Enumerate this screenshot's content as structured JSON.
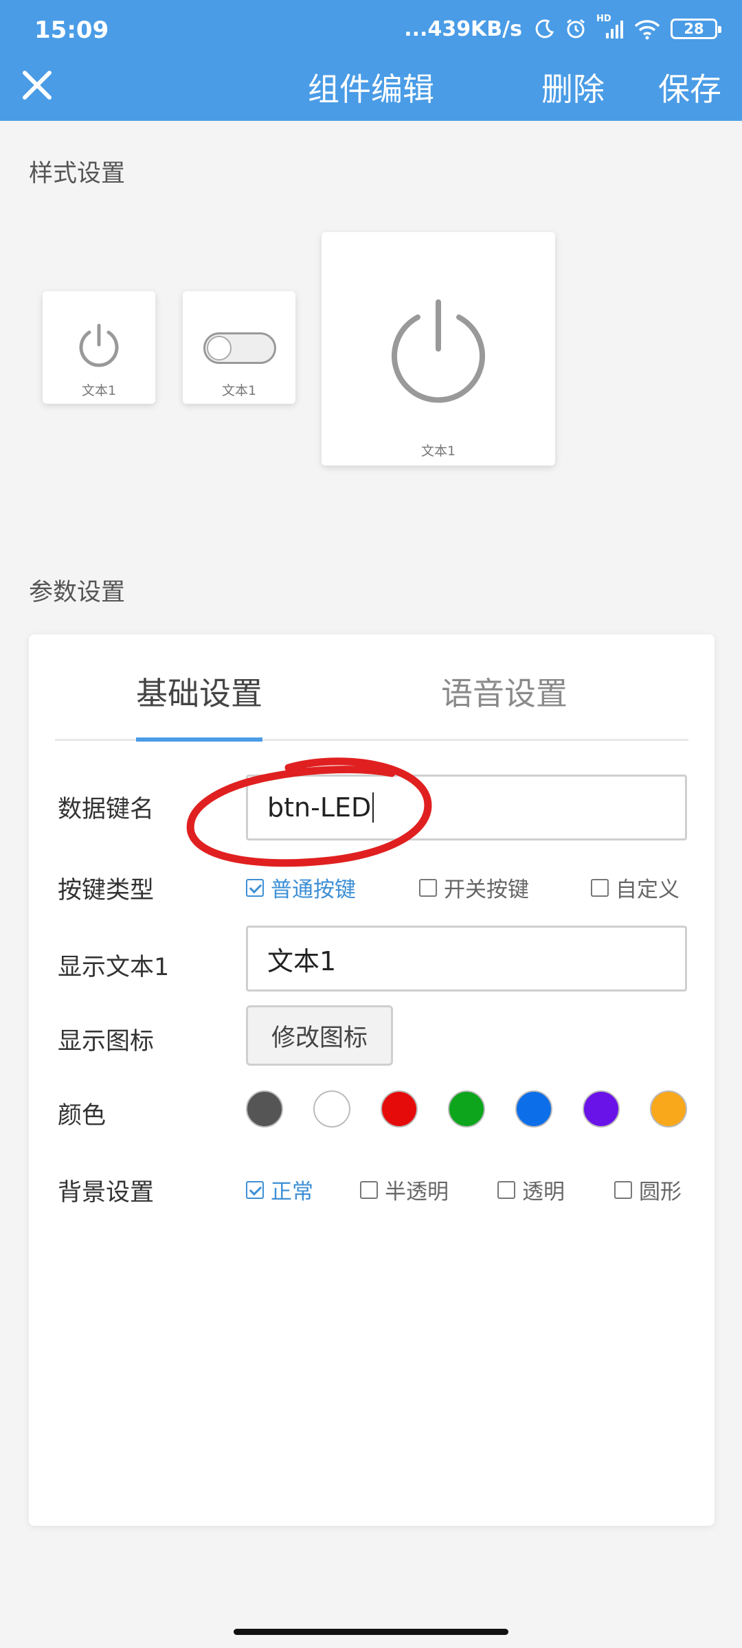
{
  "status_bar": {
    "time": "15:09",
    "network_speed": "...439KB/s",
    "network_type": "HD",
    "battery": "28",
    "icons": [
      "moon-icon",
      "alarm-icon",
      "signal-icon",
      "wifi-icon",
      "battery-icon"
    ]
  },
  "header": {
    "close_icon": "close-icon",
    "title": "组件编辑",
    "delete_label": "删除",
    "save_label": "保存"
  },
  "style_section": {
    "title": "样式设置",
    "cards": [
      {
        "label": "文本1",
        "icon": "power-icon"
      },
      {
        "label": "文本1",
        "icon": "toggle-switch-icon"
      },
      {
        "label": "文本1",
        "icon": "power-icon"
      }
    ]
  },
  "params_section": {
    "title": "参数设置",
    "tabs": [
      {
        "label": "基础设置",
        "active": true
      },
      {
        "label": "语音设置",
        "active": false
      }
    ],
    "data_key": {
      "label": "数据键名",
      "value": "btn-LED"
    },
    "key_type": {
      "label": "按键类型",
      "options": [
        {
          "label": "普通按键",
          "checked": true
        },
        {
          "label": "开关按键",
          "checked": false
        },
        {
          "label": "自定义",
          "checked": false
        }
      ]
    },
    "display_text": {
      "label": "显示文本1",
      "value": "文本1"
    },
    "display_icon": {
      "label": "显示图标",
      "button_label": "修改图标"
    },
    "color": {
      "label": "颜色",
      "swatches": [
        "#555555",
        "#ffffff",
        "#e60b0b",
        "#0ca51c",
        "#0c6ee8",
        "#6a13e8",
        "#f9a81b"
      ]
    },
    "background": {
      "label": "背景设置",
      "options": [
        {
          "label": "正常",
          "checked": true
        },
        {
          "label": "半透明",
          "checked": false
        },
        {
          "label": "透明",
          "checked": false
        },
        {
          "label": "圆形",
          "checked": false
        }
      ]
    }
  },
  "colors": {
    "primary": "#4a9ce6",
    "annotation": "#e02020"
  }
}
